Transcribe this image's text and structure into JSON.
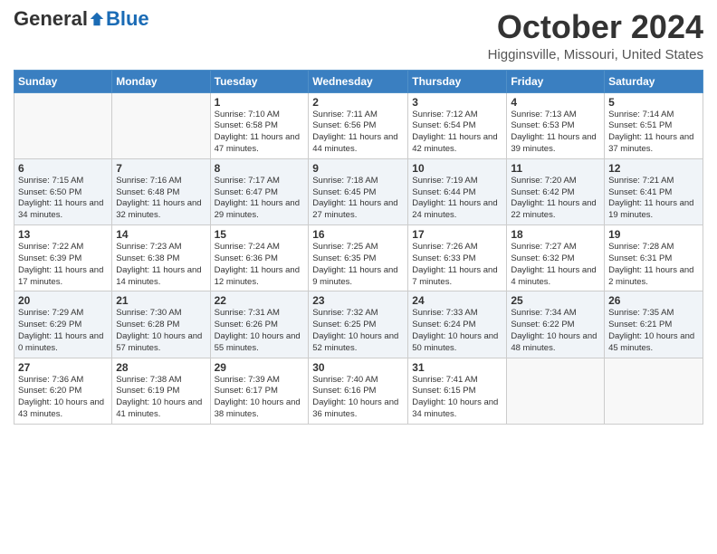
{
  "header": {
    "logo_general": "General",
    "logo_blue": "Blue",
    "month": "October 2024",
    "location": "Higginsville, Missouri, United States"
  },
  "days_of_week": [
    "Sunday",
    "Monday",
    "Tuesday",
    "Wednesday",
    "Thursday",
    "Friday",
    "Saturday"
  ],
  "weeks": [
    [
      {
        "num": "",
        "info": ""
      },
      {
        "num": "",
        "info": ""
      },
      {
        "num": "1",
        "info": "Sunrise: 7:10 AM\nSunset: 6:58 PM\nDaylight: 11 hours and 47 minutes."
      },
      {
        "num": "2",
        "info": "Sunrise: 7:11 AM\nSunset: 6:56 PM\nDaylight: 11 hours and 44 minutes."
      },
      {
        "num": "3",
        "info": "Sunrise: 7:12 AM\nSunset: 6:54 PM\nDaylight: 11 hours and 42 minutes."
      },
      {
        "num": "4",
        "info": "Sunrise: 7:13 AM\nSunset: 6:53 PM\nDaylight: 11 hours and 39 minutes."
      },
      {
        "num": "5",
        "info": "Sunrise: 7:14 AM\nSunset: 6:51 PM\nDaylight: 11 hours and 37 minutes."
      }
    ],
    [
      {
        "num": "6",
        "info": "Sunrise: 7:15 AM\nSunset: 6:50 PM\nDaylight: 11 hours and 34 minutes."
      },
      {
        "num": "7",
        "info": "Sunrise: 7:16 AM\nSunset: 6:48 PM\nDaylight: 11 hours and 32 minutes."
      },
      {
        "num": "8",
        "info": "Sunrise: 7:17 AM\nSunset: 6:47 PM\nDaylight: 11 hours and 29 minutes."
      },
      {
        "num": "9",
        "info": "Sunrise: 7:18 AM\nSunset: 6:45 PM\nDaylight: 11 hours and 27 minutes."
      },
      {
        "num": "10",
        "info": "Sunrise: 7:19 AM\nSunset: 6:44 PM\nDaylight: 11 hours and 24 minutes."
      },
      {
        "num": "11",
        "info": "Sunrise: 7:20 AM\nSunset: 6:42 PM\nDaylight: 11 hours and 22 minutes."
      },
      {
        "num": "12",
        "info": "Sunrise: 7:21 AM\nSunset: 6:41 PM\nDaylight: 11 hours and 19 minutes."
      }
    ],
    [
      {
        "num": "13",
        "info": "Sunrise: 7:22 AM\nSunset: 6:39 PM\nDaylight: 11 hours and 17 minutes."
      },
      {
        "num": "14",
        "info": "Sunrise: 7:23 AM\nSunset: 6:38 PM\nDaylight: 11 hours and 14 minutes."
      },
      {
        "num": "15",
        "info": "Sunrise: 7:24 AM\nSunset: 6:36 PM\nDaylight: 11 hours and 12 minutes."
      },
      {
        "num": "16",
        "info": "Sunrise: 7:25 AM\nSunset: 6:35 PM\nDaylight: 11 hours and 9 minutes."
      },
      {
        "num": "17",
        "info": "Sunrise: 7:26 AM\nSunset: 6:33 PM\nDaylight: 11 hours and 7 minutes."
      },
      {
        "num": "18",
        "info": "Sunrise: 7:27 AM\nSunset: 6:32 PM\nDaylight: 11 hours and 4 minutes."
      },
      {
        "num": "19",
        "info": "Sunrise: 7:28 AM\nSunset: 6:31 PM\nDaylight: 11 hours and 2 minutes."
      }
    ],
    [
      {
        "num": "20",
        "info": "Sunrise: 7:29 AM\nSunset: 6:29 PM\nDaylight: 11 hours and 0 minutes."
      },
      {
        "num": "21",
        "info": "Sunrise: 7:30 AM\nSunset: 6:28 PM\nDaylight: 10 hours and 57 minutes."
      },
      {
        "num": "22",
        "info": "Sunrise: 7:31 AM\nSunset: 6:26 PM\nDaylight: 10 hours and 55 minutes."
      },
      {
        "num": "23",
        "info": "Sunrise: 7:32 AM\nSunset: 6:25 PM\nDaylight: 10 hours and 52 minutes."
      },
      {
        "num": "24",
        "info": "Sunrise: 7:33 AM\nSunset: 6:24 PM\nDaylight: 10 hours and 50 minutes."
      },
      {
        "num": "25",
        "info": "Sunrise: 7:34 AM\nSunset: 6:22 PM\nDaylight: 10 hours and 48 minutes."
      },
      {
        "num": "26",
        "info": "Sunrise: 7:35 AM\nSunset: 6:21 PM\nDaylight: 10 hours and 45 minutes."
      }
    ],
    [
      {
        "num": "27",
        "info": "Sunrise: 7:36 AM\nSunset: 6:20 PM\nDaylight: 10 hours and 43 minutes."
      },
      {
        "num": "28",
        "info": "Sunrise: 7:38 AM\nSunset: 6:19 PM\nDaylight: 10 hours and 41 minutes."
      },
      {
        "num": "29",
        "info": "Sunrise: 7:39 AM\nSunset: 6:17 PM\nDaylight: 10 hours and 38 minutes."
      },
      {
        "num": "30",
        "info": "Sunrise: 7:40 AM\nSunset: 6:16 PM\nDaylight: 10 hours and 36 minutes."
      },
      {
        "num": "31",
        "info": "Sunrise: 7:41 AM\nSunset: 6:15 PM\nDaylight: 10 hours and 34 minutes."
      },
      {
        "num": "",
        "info": ""
      },
      {
        "num": "",
        "info": ""
      }
    ]
  ]
}
